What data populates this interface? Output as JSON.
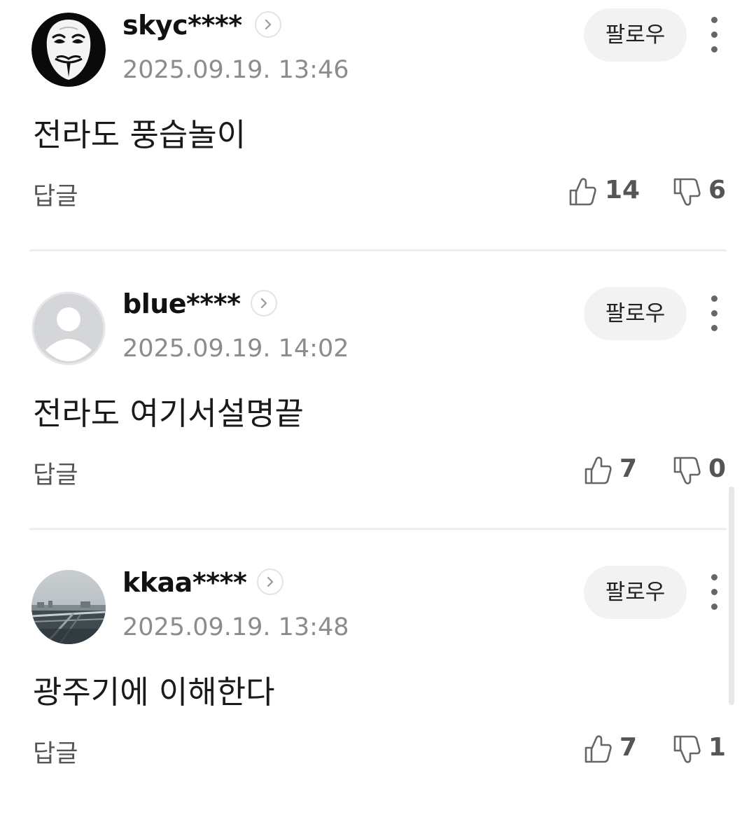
{
  "comments": [
    {
      "username": "skyc****",
      "timestamp": "2025.09.19. 13:46",
      "follow_label": "팔로우",
      "text": "전라도 풍습놀이",
      "reply_label": "답글",
      "likes": "14",
      "dislikes": "6",
      "avatar": "guy-fawkes-mask-avatar"
    },
    {
      "username": "blue****",
      "timestamp": "2025.09.19. 14:02",
      "follow_label": "팔로우",
      "text": "전라도 여기서설명끝",
      "reply_label": "답글",
      "likes": "7",
      "dislikes": "0",
      "avatar": "default-person-avatar"
    },
    {
      "username": "kkaa****",
      "timestamp": "2025.09.19. 13:48",
      "follow_label": "팔로우",
      "text": "광주기에 이해한다",
      "reply_label": "답글",
      "likes": "7",
      "dislikes": "1",
      "avatar": "city-bridge-photo-avatar"
    }
  ],
  "icons": {
    "profile_link": "chevron-right-icon",
    "more": "more-vertical-icon",
    "like": "thumbs-up-icon",
    "dislike": "thumbs-down-icon"
  },
  "colors": {
    "username": "#111111",
    "timestamp": "#8c8c8c",
    "follow_button_bg": "#f2f2f2",
    "divider": "#eeeeee",
    "vote_count": "#555555"
  }
}
